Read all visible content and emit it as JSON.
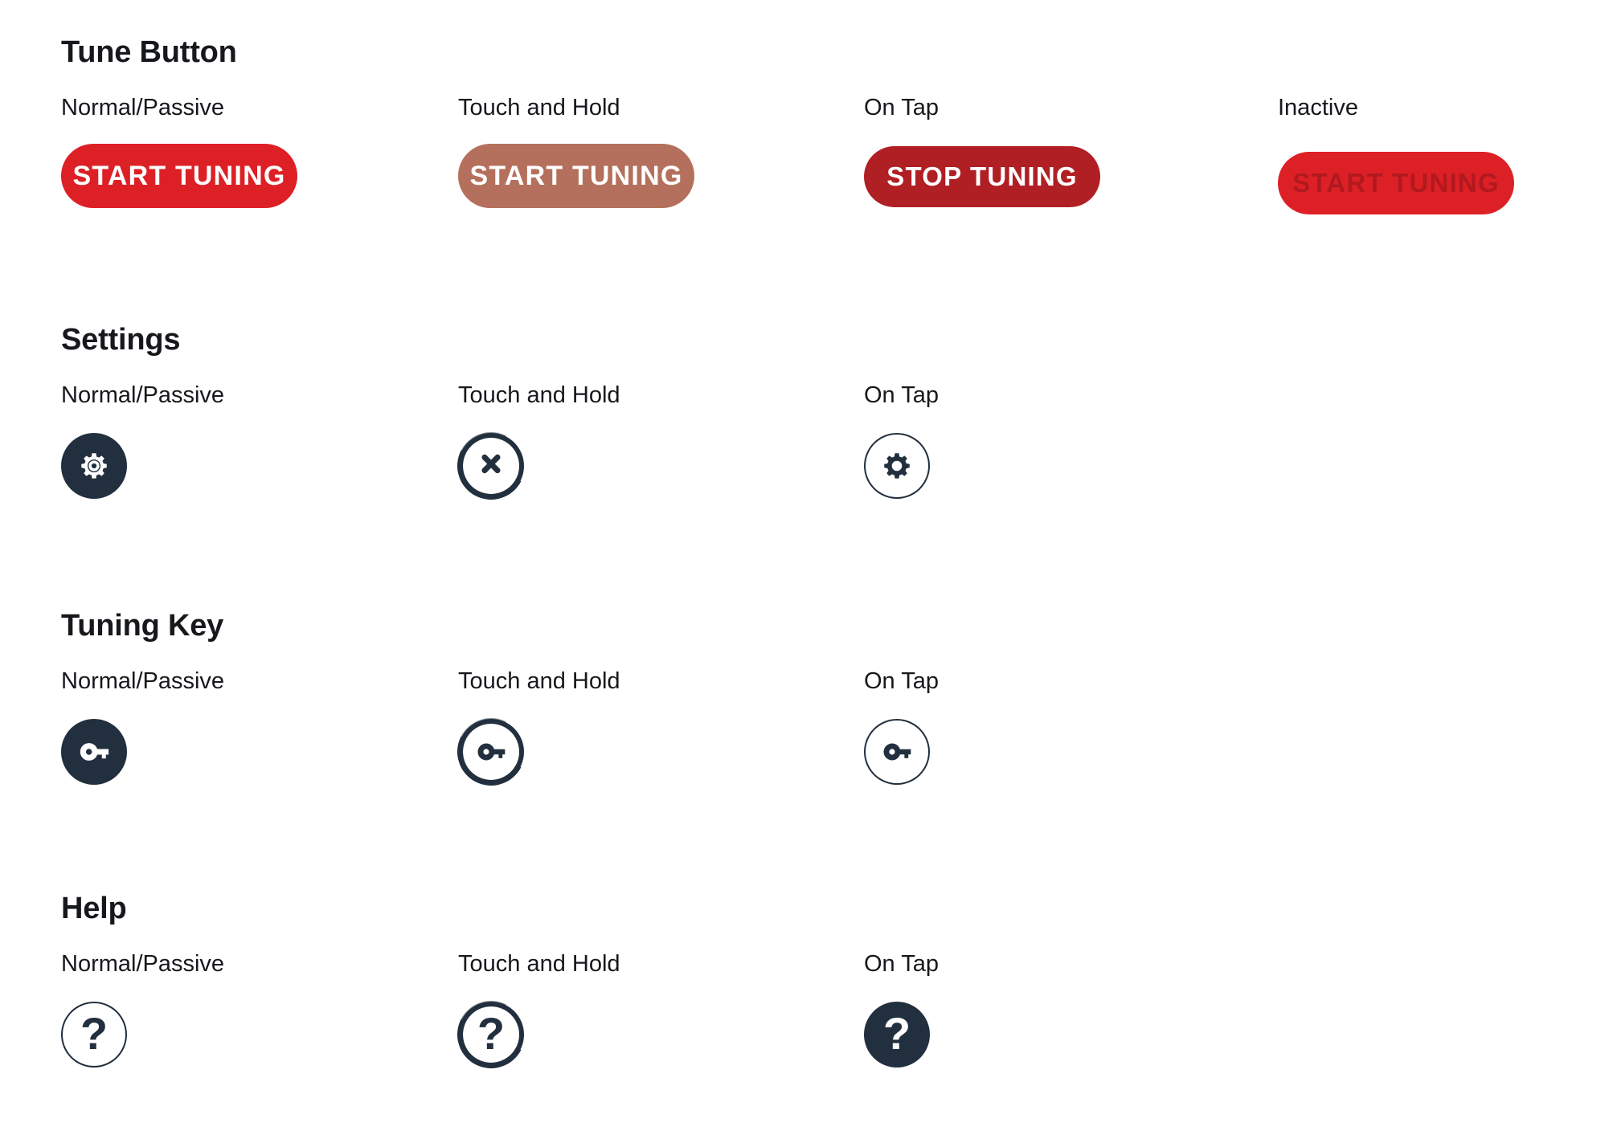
{
  "colors": {
    "navy": "#222f3e",
    "red_normal": "#dd2026",
    "red_ontap": "#b01f24",
    "red_inactive_text": "#b1191f",
    "brown_hold": "#b4705c",
    "shadow": "#9aa3ad",
    "white": "#ffffff"
  },
  "sections": [
    {
      "title": "Tune Button",
      "variants": [
        {
          "label": "Normal/Passive",
          "control": "START TUNING",
          "icon": "pill-button"
        },
        {
          "label": "Touch and Hold",
          "control": "START TUNING",
          "icon": "pill-button"
        },
        {
          "label": "On Tap",
          "control": "STOP TUNING",
          "icon": "pill-button"
        },
        {
          "label": "Inactive",
          "control": "START TUNING",
          "icon": "pill-button"
        }
      ]
    },
    {
      "title": "Settings",
      "variants": [
        {
          "label": "Normal/Passive",
          "control": "",
          "icon": "gear-icon"
        },
        {
          "label": "Touch and Hold",
          "control": "",
          "icon": "close-x-icon"
        },
        {
          "label": "On Tap",
          "control": "",
          "icon": "gear-icon"
        }
      ]
    },
    {
      "title": "Tuning Key",
      "variants": [
        {
          "label": "Normal/Passive",
          "control": "",
          "icon": "key-icon"
        },
        {
          "label": "Touch and Hold",
          "control": "",
          "icon": "key-icon"
        },
        {
          "label": "On Tap",
          "control": "",
          "icon": "key-icon"
        }
      ]
    },
    {
      "title": "Help",
      "variants": [
        {
          "label": "Normal/Passive",
          "control": "?",
          "icon": "question-mark-icon"
        },
        {
          "label": "Touch and Hold",
          "control": "?",
          "icon": "question-mark-icon"
        },
        {
          "label": "On Tap",
          "control": "?",
          "icon": "question-mark-icon"
        }
      ]
    }
  ]
}
